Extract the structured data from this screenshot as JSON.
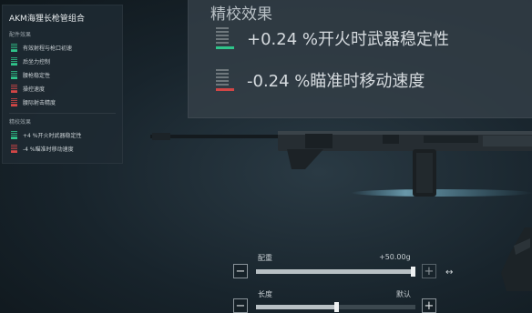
{
  "panel": {
    "title": "AKM海狸长枪管组合",
    "section_attachment": "配件效果",
    "attachment_effects": [
      {
        "text": "有效射程与枪口初速",
        "trend": "up"
      },
      {
        "text": "后坐力控制",
        "trend": "up"
      },
      {
        "text": "腰枪稳定性",
        "trend": "up"
      },
      {
        "text": "操控速度",
        "trend": "down"
      },
      {
        "text": "腰际射击精度",
        "trend": "down"
      }
    ],
    "section_tuning": "精校效果",
    "tuning_effects": [
      {
        "text": "+4 %开火时武器稳定性",
        "trend": "up"
      },
      {
        "text": "-4 %瞄准时移动速度",
        "trend": "down"
      }
    ]
  },
  "tooltip": {
    "title": "精校效果",
    "effects": [
      {
        "text": "+0.24 %开火时武器稳定性",
        "trend": "up"
      },
      {
        "text": "-0.24 %瞄准时移动速度",
        "trend": "down"
      }
    ]
  },
  "sliders": {
    "weight": {
      "label": "配重",
      "value_text": "+50.00g",
      "level": 1.0
    },
    "length": {
      "label": "长度",
      "value_text": "默认",
      "level": 0.5
    }
  },
  "colors": {
    "positive": "#2fc48a",
    "negative": "#d24646"
  }
}
